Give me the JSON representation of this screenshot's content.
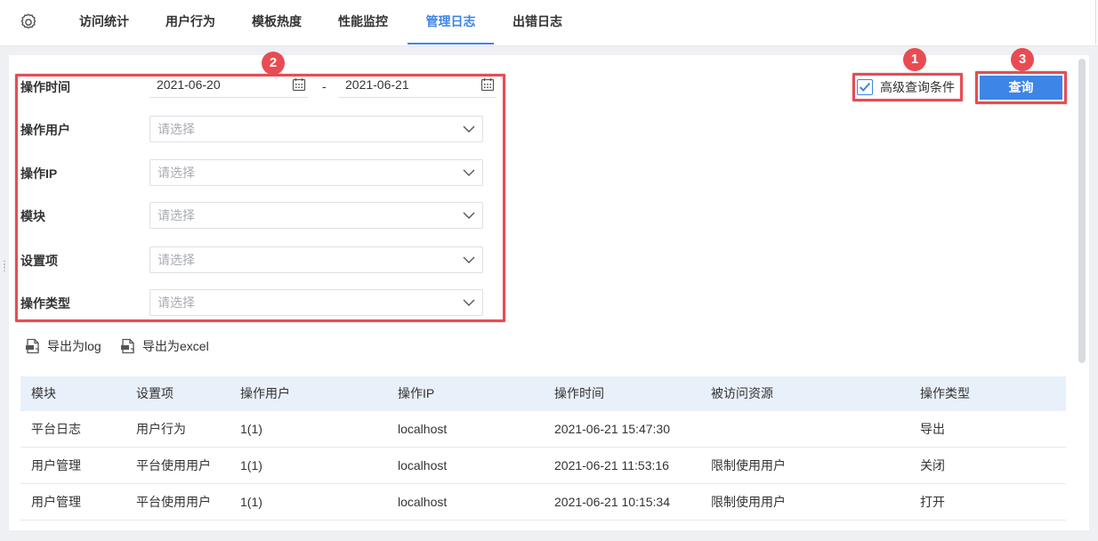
{
  "nav": {
    "tabs": [
      {
        "label": "访问统计"
      },
      {
        "label": "用户行为"
      },
      {
        "label": "模板热度"
      },
      {
        "label": "性能监控"
      },
      {
        "label": "管理日志"
      },
      {
        "label": "出错日志"
      }
    ],
    "active_tab": "管理日志"
  },
  "form": {
    "time_label": "操作时间",
    "date_start": "2021-06-20",
    "date_separator": "-",
    "date_end": "2021-06-21",
    "user_label": "操作用户",
    "ip_label": "操作IP",
    "module_label": "模块",
    "setting_label": "设置项",
    "type_label": "操作类型",
    "placeholder": "请选择"
  },
  "advanced": {
    "label": "高级查询条件",
    "checked": true
  },
  "query_button": "查询",
  "badges": [
    "1",
    "2",
    "3"
  ],
  "export": {
    "log": "导出为log",
    "excel": "导出为excel"
  },
  "table": {
    "headers": [
      "模块",
      "设置项",
      "操作用户",
      "操作IP",
      "操作时间",
      "被访问资源",
      "操作类型"
    ],
    "rows": [
      [
        "平台日志",
        "用户行为",
        "1(1)",
        "localhost",
        "2021-06-21 15:47:30",
        "",
        "导出"
      ],
      [
        "用户管理",
        "平台使用用户",
        "1(1)",
        "localhost",
        "2021-06-21 11:53:16",
        "限制使用用户",
        "关闭"
      ],
      [
        "用户管理",
        "平台使用用户",
        "1(1)",
        "localhost",
        "2021-06-21 10:15:34",
        "限制使用用户",
        "打开"
      ]
    ]
  },
  "colors": {
    "accent": "#3d85e6",
    "highlight": "#e84c52",
    "table_header_bg": "#e8f0fa"
  },
  "icons": {
    "settings": "gear-icon",
    "calendar": "calendar-icon",
    "dropdown": "chevron-down-icon",
    "export": "export-file-icon",
    "check": "check-icon"
  }
}
